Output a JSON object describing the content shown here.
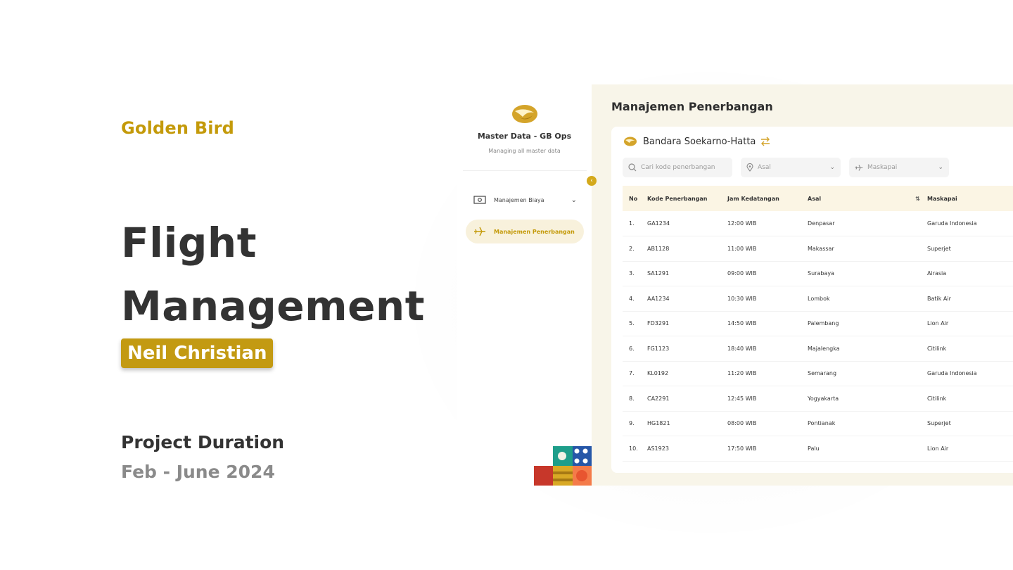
{
  "hero": {
    "brand": "Golden Bird",
    "title_line1": "Flight",
    "title_line2": "Management",
    "author": "Neil Christian",
    "duration_label": "Project Duration",
    "duration_value": "Feb - June 2024"
  },
  "colors": {
    "accent": "#c49a0a",
    "app_bg": "#f8f5e9",
    "header_bg": "#fbf5e4"
  },
  "sidebar": {
    "title": "Master Data - GB Ops",
    "subtitle": "Managing all master data",
    "items": [
      {
        "label": "Manajemen Biaya",
        "icon": "money-icon",
        "active": false
      },
      {
        "label": "Manajemen Penerbangan",
        "icon": "airplane-icon",
        "active": true
      }
    ]
  },
  "main": {
    "title": "Manajemen Penerbangan",
    "airport": "Bandara Soekarno-Hatta",
    "search_placeholder": "Cari kode penerbangan",
    "filter_asal": "Asal",
    "filter_maskapai": "Maskapai",
    "columns": [
      "No",
      "Kode Penerbangan",
      "Jam Kedatangan",
      "Asal",
      "Maskapai"
    ],
    "rows": [
      [
        "1.",
        "GA1234",
        "12:00 WIB",
        "Denpasar",
        "Garuda Indonesia"
      ],
      [
        "2.",
        "AB1128",
        "11:00 WIB",
        "Makassar",
        "Superjet"
      ],
      [
        "3.",
        "SA1291",
        "09:00 WIB",
        "Surabaya",
        "Airasia"
      ],
      [
        "4.",
        "AA1234",
        "10:30 WIB",
        "Lombok",
        "Batik Air"
      ],
      [
        "5.",
        "FD3291",
        "14:50 WIB",
        "Palembang",
        "Lion Air"
      ],
      [
        "6.",
        "FG1123",
        "18:40 WIB",
        "Majalengka",
        "Citilink"
      ],
      [
        "7.",
        "KL0192",
        "11:20 WIB",
        "Semarang",
        "Garuda Indonesia"
      ],
      [
        "8.",
        "CA2291",
        "12:45 WIB",
        "Yogyakarta",
        "Citilink"
      ],
      [
        "9.",
        "HG1821",
        "08:00 WIB",
        "Pontianak",
        "Superjet"
      ],
      [
        "10.",
        "AS1923",
        "17:50 WIB",
        "Palu",
        "Lion Air"
      ]
    ]
  }
}
